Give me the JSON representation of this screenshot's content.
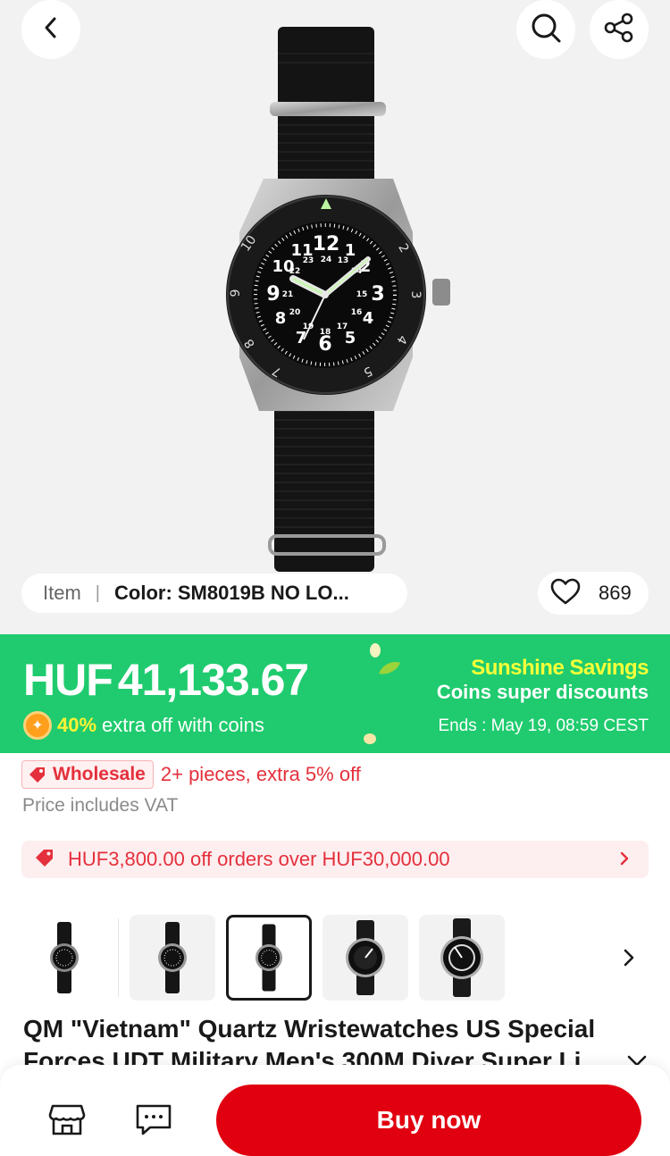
{
  "gallery": {
    "variant": {
      "item_label": "Item",
      "separator": "|",
      "color_value": "Color: SM8019B NO LO..."
    },
    "favorites_count": "869",
    "thumbnails": [
      "watch-photo-1",
      "watch-photo-2",
      "watch-photo-3",
      "watch-photo-4",
      "watch-photo-5"
    ],
    "selected_thumbnail": 3,
    "dial_numerals": [
      "12",
      "24",
      "13",
      "2",
      "14",
      "3",
      "15",
      "4",
      "16",
      "5",
      "17",
      "6",
      "18",
      "7",
      "19",
      "8",
      "20",
      "9",
      "21",
      "10",
      "22",
      "11",
      "23"
    ],
    "bezel_numerals": [
      "10",
      "2",
      "3",
      "4",
      "5",
      "9",
      "8",
      "7"
    ]
  },
  "price_banner": {
    "currency": "HUF",
    "amount": "41,133.67",
    "coin_percent": "40%",
    "coin_text": "extra off with coins",
    "promo_title": "Sunshine Savings",
    "promo_subtitle": "Coins super discounts",
    "ends": "Ends : May 19, 08:59 CEST"
  },
  "wholesale": {
    "badge": "Wholesale",
    "text": "2+ pieces, extra 5% off",
    "vat_note": "Price includes VAT"
  },
  "coupon": {
    "text": "HUF3,800.00 off orders over HUF30,000.00"
  },
  "product": {
    "title": "QM \"Vietnam\" Quartz Wristewatches  US Special Forces UDT Military Men's 300M Diver Super Li..."
  },
  "bottom_bar": {
    "buy_label": "Buy now"
  },
  "colors": {
    "brand_red": "#e1000f",
    "banner_green": "#1fcb6e",
    "promo_yellow": "#f5ff3a",
    "coin_yellow": "#fff235",
    "wholesale_red": "#e4303c"
  },
  "icons": [
    "back-arrow-icon",
    "search-icon",
    "share-icon",
    "heart-icon",
    "coin-icon",
    "leaf-icon",
    "tag-icon",
    "coupon-tag-icon",
    "chevron-right-icon",
    "chevron-down-icon",
    "store-icon",
    "message-icon"
  ]
}
